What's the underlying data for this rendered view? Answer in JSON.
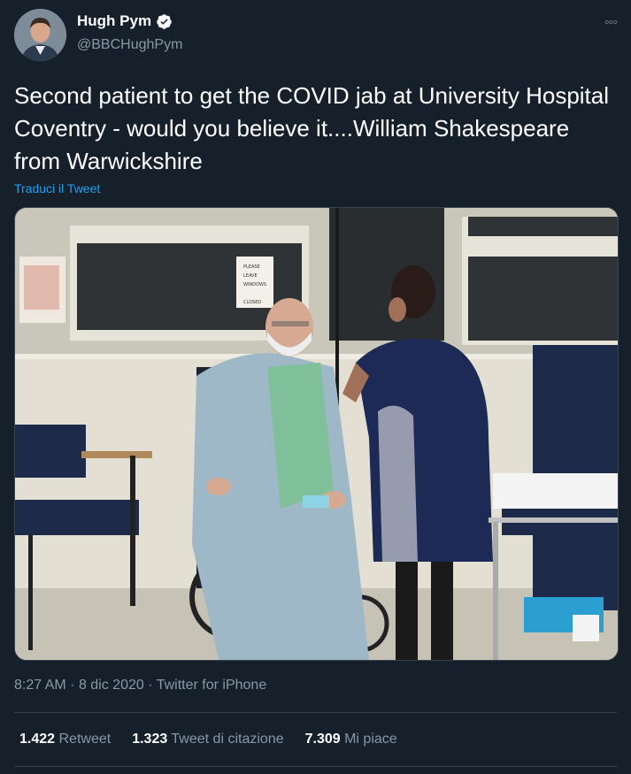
{
  "author": {
    "name": "Hugh Pym",
    "handle": "@BBCHughPym",
    "verified": true,
    "avatar_icon": "profile-photo"
  },
  "more_icon": "ellipsis-icon",
  "tweet": {
    "text": "Second patient to get the COVID jab at University Hospital Coventry - would you believe it....William Shakespeare from Warwickshire",
    "translate_label": "Traduci il Tweet"
  },
  "meta": {
    "time": "8:27 AM",
    "separator": "·",
    "date": "8 dic 2020",
    "source": "Twitter for iPhone"
  },
  "stats": [
    {
      "value": "1.422",
      "label": "Retweet"
    },
    {
      "value": "1.323",
      "label": "Tweet di citazione"
    },
    {
      "value": "7.309",
      "label": "Mi piace"
    }
  ],
  "media": {
    "sign_lines": [
      "PLEASE",
      "LEAVE",
      "WINDOWS",
      "CLOSED"
    ]
  },
  "colors": {
    "background": "#15202b",
    "secondary_text": "#8899a6",
    "link": "#1da1f2",
    "border": "#38444d"
  }
}
